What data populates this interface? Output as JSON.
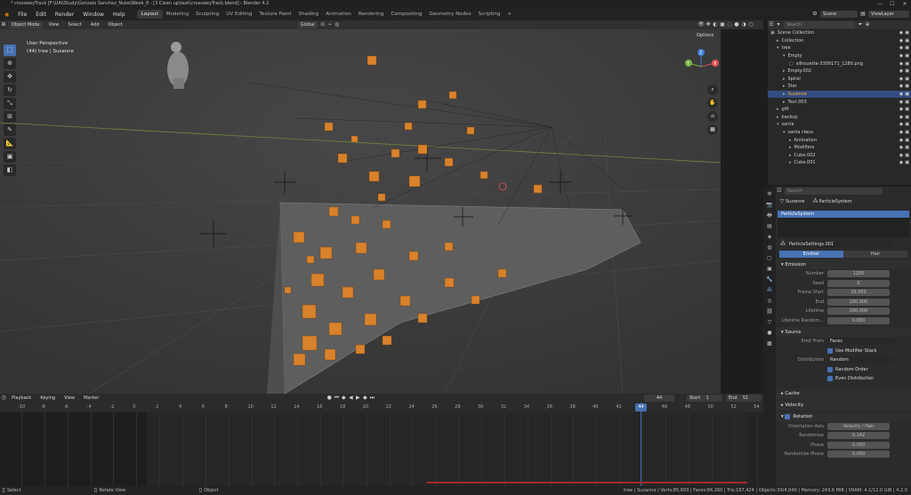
{
  "title_bar": {
    "text": "* crossweyTrack [F:\\UAI\\Study\\Gonzalo Sanchez_Nuke\\Week_8 - [3 Clean up\\task\\crossweyTrack.blend] - Blender 4.2",
    "minimize": "—",
    "maximize": "☐",
    "close": "✕"
  },
  "menu": [
    "File",
    "Edit",
    "Render",
    "Window",
    "Help"
  ],
  "workspaces": [
    "Layout",
    "Modeling",
    "Sculpting",
    "UV Editing",
    "Texture Paint",
    "Shading",
    "Animation",
    "Rendering",
    "Compositing",
    "Geometry Nodes",
    "Scripting",
    "+"
  ],
  "topright": {
    "scene": "Scene",
    "view_layer": "ViewLayer"
  },
  "viewport_header": {
    "mode": "Object Mode",
    "menus": [
      "View",
      "Select",
      "Add",
      "Object"
    ],
    "transform": "Global",
    "options": "Options"
  },
  "viewport": {
    "perspective": "User Perspective",
    "object_info": "(44) tree | Suzanne"
  },
  "gizmo": {
    "x": "X",
    "y": "Y",
    "z": "Z"
  },
  "outliner": {
    "search_placeholder": "Search",
    "rows": [
      {
        "label": "Scene Collection",
        "indent": 0,
        "icon": "▣",
        "sel": false
      },
      {
        "label": "Collection",
        "indent": 1,
        "icon": "▸",
        "sel": false
      },
      {
        "label": "tree",
        "indent": 1,
        "icon": "▾",
        "sel": false
      },
      {
        "label": "Empty",
        "indent": 2,
        "icon": "▾",
        "sel": false
      },
      {
        "label": "silhouette-3309171_1280.png",
        "indent": 3,
        "icon": "▢",
        "sel": false
      },
      {
        "label": "Empty.002",
        "indent": 2,
        "icon": "▸",
        "sel": false
      },
      {
        "label": "Spiral",
        "indent": 2,
        "icon": "▸",
        "sel": false
      },
      {
        "label": "Star",
        "indent": 2,
        "icon": "▸",
        "sel": false
      },
      {
        "label": "Suzanne",
        "indent": 2,
        "icon": "▸",
        "sel": true
      },
      {
        "label": "Text.003",
        "indent": 2,
        "icon": "▸",
        "sel": false
      },
      {
        "label": "gift",
        "indent": 1,
        "icon": "▸",
        "sel": false
      },
      {
        "label": "backup",
        "indent": 1,
        "icon": "▸",
        "sel": false
      },
      {
        "label": "santa",
        "indent": 1,
        "icon": "▾",
        "sel": false
      },
      {
        "label": "santa claus",
        "indent": 2,
        "icon": "▾",
        "sel": false
      },
      {
        "label": "Animation",
        "indent": 3,
        "icon": "▸",
        "sel": false
      },
      {
        "label": "Modifiers",
        "indent": 3,
        "icon": "▸",
        "sel": false
      },
      {
        "label": "Cube.002",
        "indent": 3,
        "icon": "▸",
        "sel": false
      },
      {
        "label": "Cube.001",
        "indent": 3,
        "icon": "▸",
        "sel": false
      }
    ]
  },
  "properties": {
    "search_placeholder": "Search",
    "breadcrumb_object": "Suzanne",
    "breadcrumb_system": "ParticleSystem",
    "system_list_item": "ParticleSystem",
    "settings_name": "ParticleSettings.001",
    "type_tabs": [
      "Emitter",
      "Hair"
    ],
    "emission_title": "Emission",
    "emission": [
      {
        "label": "Number",
        "value": "1200"
      },
      {
        "label": "Seed",
        "value": "0"
      },
      {
        "label": "Frame Start",
        "value": "29.000"
      },
      {
        "label": "End",
        "value": "100.000"
      },
      {
        "label": "Lifetime",
        "value": "100.000"
      },
      {
        "label": "Lifetime Random...",
        "value": "0.000"
      }
    ],
    "source_title": "Source",
    "emit_from_label": "Emit From",
    "emit_from_value": "Faces",
    "use_modifier_stack": "Use Modifier Stack",
    "distribution_label": "Distribution",
    "distribution_value": "Random",
    "random_order": "Random Order",
    "even_distribution": "Even Distribution",
    "cache_title": "Cache",
    "velocity_title": "Velocity",
    "rotation_title": "Rotation",
    "rotation": [
      {
        "label": "Orientation Axis",
        "value": "Velocity / Hair"
      },
      {
        "label": "Randomize",
        "value": "0.142"
      },
      {
        "label": "Phase",
        "value": "0.000"
      },
      {
        "label": "Randomize Phase",
        "value": "0.000"
      }
    ]
  },
  "timeline": {
    "menus": [
      "Playback",
      "Keying",
      "View",
      "Marker"
    ],
    "current_frame": "44",
    "start_label": "Start",
    "start": "1",
    "end_label": "End",
    "end": "51",
    "ticks": [
      "-10",
      "-8",
      "-6",
      "-4",
      "-2",
      "0",
      "2",
      "4",
      "6",
      "8",
      "10",
      "12",
      "14",
      "16",
      "18",
      "20",
      "22",
      "24",
      "26",
      "28",
      "30",
      "32",
      "34",
      "36",
      "38",
      "40",
      "42",
      "44",
      "46",
      "48",
      "50",
      "52",
      "54"
    ]
  },
  "statusbar": {
    "select": "Select",
    "rotate_view": "Rotate View",
    "object": "Object",
    "stats": "tree | Suzanne | Verts:85,693 | Faces:84,260 | Tris:167,424 | Objects:30/4,040 | Memory: 243.6 MiB | VRAM: 4.1/12.0 GiB | 4.2.0"
  }
}
